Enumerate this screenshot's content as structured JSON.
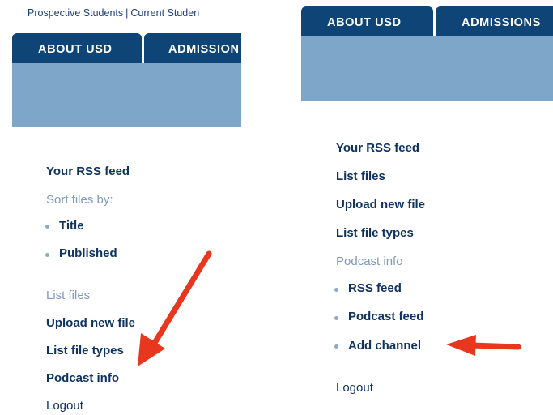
{
  "left": {
    "top_links": [
      "Prospective Students",
      "Current Studen"
    ],
    "top_links_separator": "|",
    "tabs": [
      "ABOUT USD",
      "ADMISSION"
    ],
    "nav": {
      "your_rss_feed": "Your RSS feed",
      "sort_by_label": "Sort files by:",
      "sort_options": [
        "Title",
        "Published"
      ],
      "list_files": "List files",
      "upload_new_file": "Upload new file",
      "list_file_types": "List file types",
      "podcast_info": "Podcast info",
      "logout": "Logout"
    }
  },
  "right": {
    "tabs": [
      "ABOUT USD",
      "ADMISSIONS"
    ],
    "nav": {
      "your_rss_feed": "Your RSS feed",
      "list_files": "List files",
      "upload_new_file": "Upload new file",
      "list_file_types": "List file types",
      "podcast_info": "Podcast info",
      "podcast_options": [
        "RSS feed",
        "Podcast feed",
        "Add channel"
      ],
      "logout": "Logout"
    }
  },
  "colors": {
    "tab_bg": "#0e4476",
    "banner_bg": "#7ea6c8",
    "link": "#0f3360",
    "muted_text": "#7f9ab8",
    "annotation_arrow": "#e8361f"
  }
}
